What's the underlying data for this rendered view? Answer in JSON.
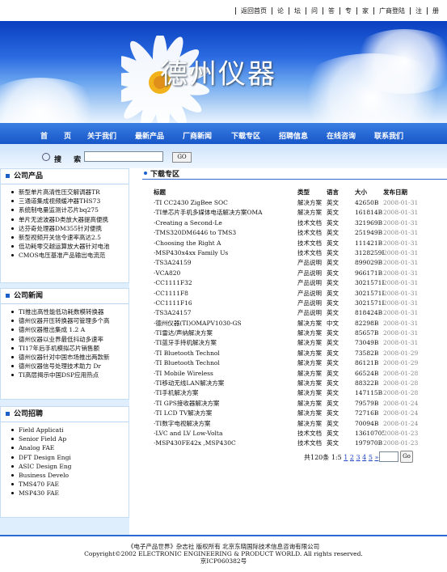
{
  "top_links": [
    "返回首页",
    "论",
    "坛",
    "问",
    "答",
    "专",
    "家",
    "广商登陆",
    "注",
    "册"
  ],
  "banner": {
    "title": "德州仪器"
  },
  "main_nav": [
    "首",
    "页",
    "关于我们",
    "最新产品",
    "厂商新闻",
    "下载专区",
    "招聘信息",
    "在线咨询",
    "联系我们"
  ],
  "search": {
    "label": "搜 索",
    "go": "GO"
  },
  "sidebar": {
    "products": {
      "title": "公司产品",
      "items": [
        "新型单片高清性压交解调器TR",
        "三通道集成视频缓冲器THS73",
        "系统制电量监测计芯片bq275",
        "单片无滤波器D类放大器提高便携",
        "达芬奇处理器DM355针对便携",
        "新型视频开关信令速率高达2.5",
        "低功耗零交越运算放大器针对电池",
        "CMOS电压基准产品输出电流范"
      ]
    },
    "news": {
      "title": "公司新闻",
      "items": [
        "TI推出高性能低功耗数模转换器",
        "德州仪器开压转换器可管理多个高",
        "德州仪器推出集成 1.2 A",
        "德州仪器以业界最低抖动多速率",
        "TI17年后手机模拟芯片销售额",
        "德州仪器针对中国市场推出两款新",
        "德州仪器信号处理技术助力 Dr",
        "TI高层揭示中国DSP应用热点"
      ]
    },
    "jobs": {
      "title": "公司招聘",
      "items": [
        "Field Applicati",
        "Senior Field Ap",
        "Analog FAE",
        "DFT Design Engi",
        "ASIC Design Eng",
        "Business Develo",
        "TMS470 FAE",
        "MSP430 FAE"
      ]
    }
  },
  "download": {
    "title": "下载专区",
    "columns": [
      "标题",
      "类型",
      "语言",
      "大小",
      "发布日期"
    ],
    "rows": [
      [
        "·TI CC2430 ZigBee SOC",
        "解决方案",
        "英文",
        "42650B",
        "2008-01-31"
      ],
      [
        "·TI单芯片手机多媒体电话解决方案OMA",
        "解决方案",
        "英文",
        "161814B",
        "2008-01-31"
      ],
      [
        "·Creating a Second-Le",
        "技术文档",
        "英文",
        "321969B",
        "2008-01-31"
      ],
      [
        "·TMS320DM6446 to TMS3",
        "技术文档",
        "英文",
        "251949B",
        "2008-01-31"
      ],
      [
        "·Choosing the Right A",
        "技术文档",
        "英文",
        "111421B",
        "2008-01-31"
      ],
      [
        "·MSP430x4xx Family Us",
        "技术文档",
        "英文",
        "3128259B",
        "2008-01-31"
      ],
      [
        "·TS3A24159",
        "产品说明",
        "英文",
        "899029B",
        "2008-01-31"
      ],
      [
        "·VCA820",
        "产品说明",
        "英文",
        "966171B",
        "2008-01-31"
      ],
      [
        "·CC1111F32",
        "产品说明",
        "英文",
        "3021571B",
        "2008-01-31"
      ],
      [
        "·CC1111F8",
        "产品说明",
        "英文",
        "3021571B",
        "2008-01-31"
      ],
      [
        "·CC1111F16",
        "产品说明",
        "英文",
        "3021571B",
        "2008-01-31"
      ],
      [
        "·TS3A24157",
        "产品说明",
        "英文",
        "818424B",
        "2008-01-31"
      ],
      [
        "·德州仪器(TI)OMAPV1030-GS",
        "解决方案",
        "中文",
        "82298B",
        "2008-01-31"
      ],
      [
        "·TI雷达/声纳解决方案",
        "解决方案",
        "英文",
        "85657B",
        "2008-01-31"
      ],
      [
        "·TI蓝牙手持机解决方案",
        "解决方案",
        "英文",
        "73049B",
        "2008-01-31"
      ],
      [
        "·TI Bluetooth Technol",
        "解决方案",
        "英文",
        "73582B",
        "2008-01-29"
      ],
      [
        "·TI Bluetooth Technol",
        "解决方案",
        "英文",
        "86121B",
        "2008-01-29"
      ],
      [
        "·TI Mobile Wireless",
        "解决方案",
        "英文",
        "66524B",
        "2008-01-28"
      ],
      [
        "·TI移动无线LAN解决方案",
        "解决方案",
        "英文",
        "88322B",
        "2008-01-28"
      ],
      [
        "·TI手机解决方案",
        "解决方案",
        "英文",
        "147115B",
        "2008-01-28"
      ],
      [
        "·TI GPS接收器解决方案",
        "解决方案",
        "英文",
        "79579B",
        "2008-01-24"
      ],
      [
        "·TI LCD TV解决方案",
        "解决方案",
        "英文",
        "72716B",
        "2008-01-24"
      ],
      [
        "·TI数字电视解决方案",
        "解决方案",
        "英文",
        "70094B",
        "2008-01-24"
      ],
      [
        "·LVC and LV Low-Volta",
        "技术文档",
        "英文",
        "13610705B",
        "2008-01-23"
      ],
      [
        "·MSP430FE42x ,MSP430C",
        "技术文档",
        "英文",
        "197970B",
        "2008-01-23"
      ]
    ],
    "pager": {
      "total": "共120条",
      "current": "1:5",
      "pages": [
        "1",
        "2",
        "3",
        "4",
        "5"
      ],
      "next": "»",
      "go": "Go"
    }
  },
  "footer": {
    "line1": "《电子产品世界》杂志社  版权所有  北京东晓国际技术信息咨询有限公司",
    "line2": "Copyright©2002 ELECTRONIC ENGINEERING & PRODUCT WORLD. All rights reserved.",
    "line3": "京ICP060382号"
  }
}
